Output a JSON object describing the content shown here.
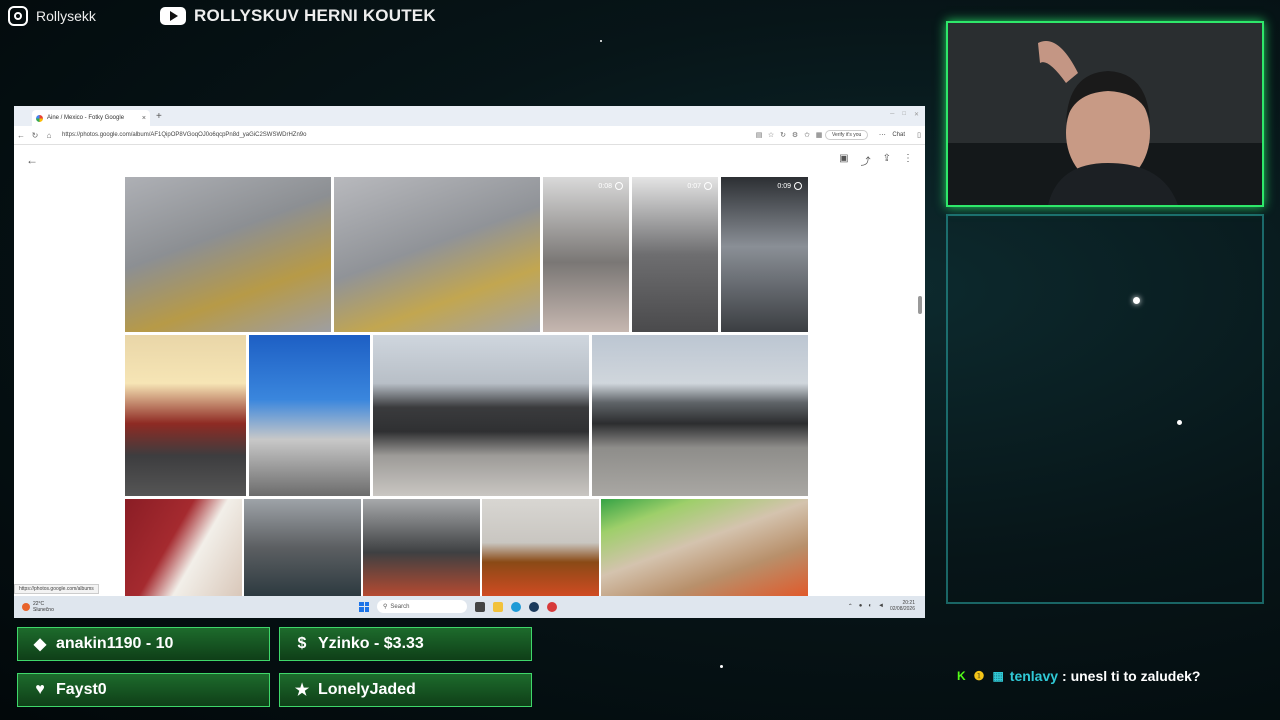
{
  "overlay": {
    "instagram_handle": "Rollysekk",
    "youtube_channel": "ROLLYSKUV HERNI KOUTEK"
  },
  "browser": {
    "tab_title": "Aine / Mexico - Fotky Google",
    "tab_close": "×",
    "new_tab": "+",
    "url": "https://photos.google.com/album/AF1QipOP8VGoqOJ0o6qcpPn8d_yaGiC2SWSWDrHZn9o",
    "verify_label": "Verify it's you",
    "chat_label": "Chat",
    "status_url": "https://photos.google.com/albums",
    "video_durations": [
      "0:08",
      "0:07",
      "0:09"
    ]
  },
  "taskbar": {
    "weather_temp": "22°C",
    "weather_desc": "Slunečno",
    "search_placeholder": "Search",
    "time": "20:21",
    "date": "02/08/2026"
  },
  "alerts": [
    {
      "icon": "drop-icon",
      "text": "anakin1190 - 10"
    },
    {
      "icon": "dollar-icon",
      "text": "Yzinko - $3.33"
    },
    {
      "icon": "heart-icon",
      "text": "Fayst0"
    },
    {
      "icon": "star-icon",
      "text": "LonelyJaded"
    }
  ],
  "chat": {
    "username": "tenlavy",
    "message": ": unesl ti to zaludek?"
  },
  "colors": {
    "alert_green": "#1d6b2c",
    "cam_border": "#2ee86a",
    "chat_user": "#30c9d6"
  }
}
